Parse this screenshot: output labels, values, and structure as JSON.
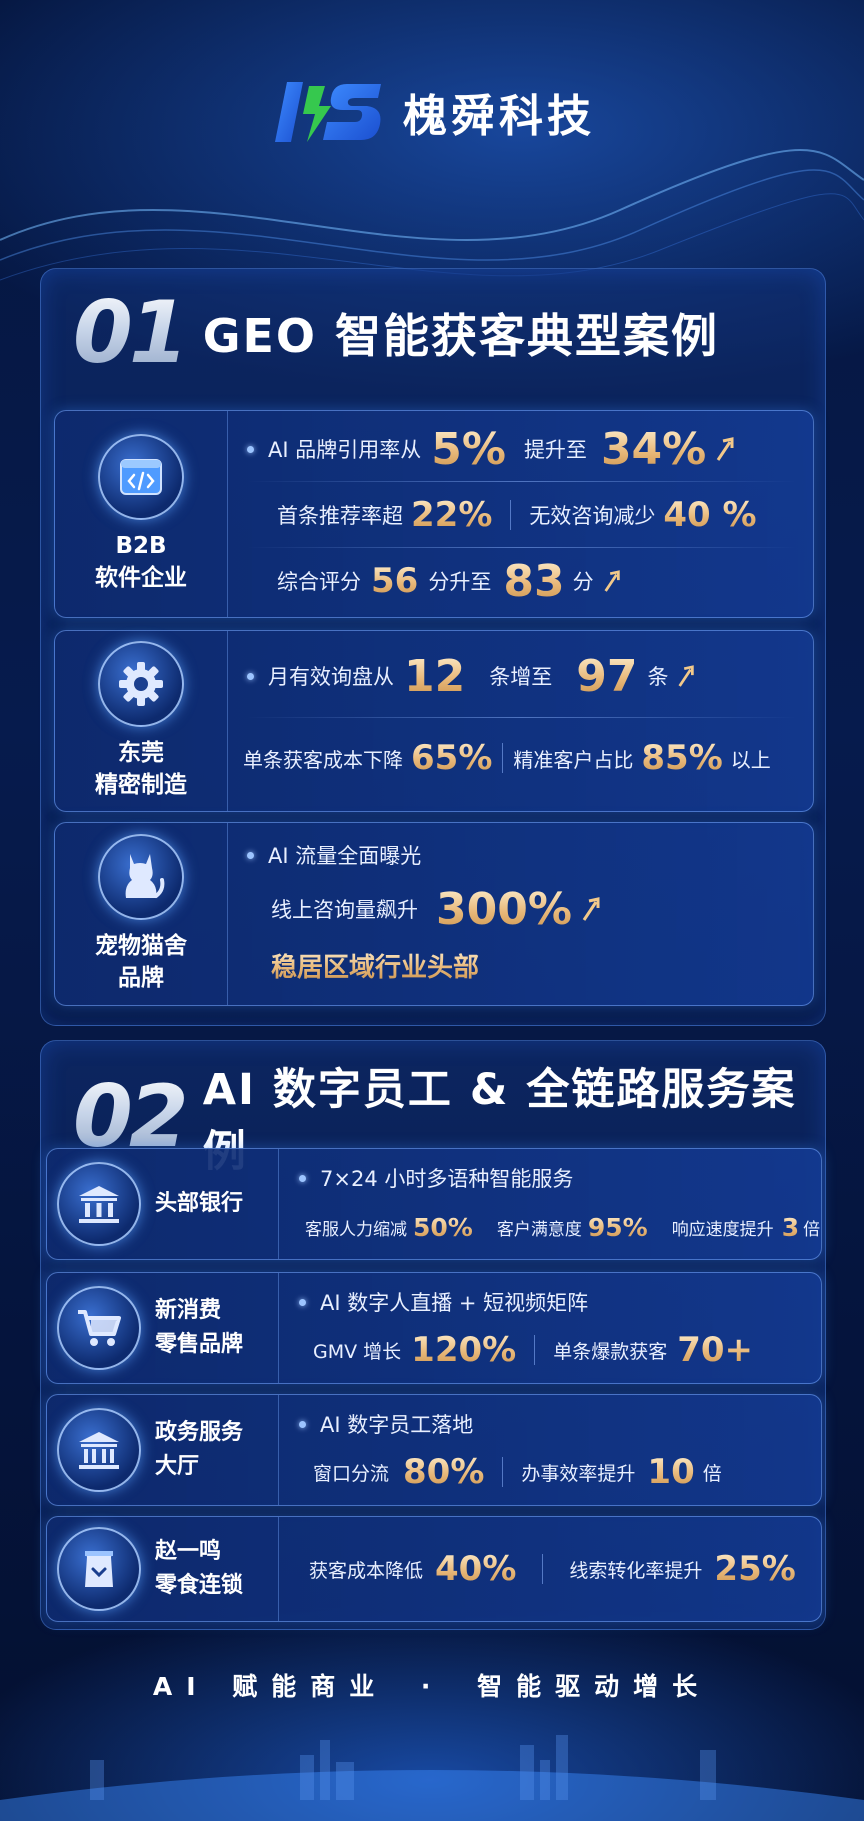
{
  "brand": {
    "name": "槐舜科技",
    "logo_text": "HS"
  },
  "section1": {
    "number": "01",
    "title": "GEO 智能获客典型案例",
    "cases": [
      {
        "name_line1": "B2B",
        "name_line2": "软件企业",
        "icon": "code-window-icon",
        "rows": [
          {
            "a": "AI 品牌引用率从",
            "v1": "5%",
            "b": "提升至",
            "v2": "34%"
          },
          {
            "a": "首条推荐率超",
            "v1": "22%",
            "b": "无效咨询减少",
            "v2": "40 %"
          },
          {
            "a": "综合评分",
            "v1": "56",
            "b": "分升至",
            "v2": "83",
            "c": "分"
          }
        ]
      },
      {
        "name_line1": "东莞",
        "name_line2": "精密制造",
        "icon": "gear-icon",
        "rows": [
          {
            "a": "月有效询盘从",
            "v1": "12",
            "b": "条增至",
            "v2": "97",
            "c": "条"
          },
          {
            "a": "单条获客成本下降",
            "v1": "65%",
            "b": "精准客户占比",
            "v2": "85%",
            "c": "以上"
          }
        ]
      },
      {
        "name_line1": "宠物猫舍",
        "name_line2": "品牌",
        "icon": "cat-icon",
        "rows": [
          {
            "a": "AI 流量全面曝光"
          },
          {
            "a": "线上咨询量飙升",
            "v1": "300%"
          },
          {
            "a": "稳居区域行业头部"
          }
        ]
      }
    ]
  },
  "section2": {
    "number": "02",
    "title": "AI 数字员工 & 全链路服务案例",
    "cases": [
      {
        "name_line1": "头部银行",
        "name_line2": "",
        "icon": "bank-icon",
        "headline": "7×24 小时多语种智能服务",
        "stats": [
          {
            "label": "客服人力缩减",
            "value": "50%",
            "unit": ""
          },
          {
            "label": "客户满意度",
            "value": "95%",
            "unit": ""
          },
          {
            "label": "响应速度提升",
            "value": "3",
            "unit": "倍"
          }
        ]
      },
      {
        "name_line1": "新消费",
        "name_line2": "零售品牌",
        "icon": "shopping-cart-icon",
        "headline": "AI 数字人直播 + 短视频矩阵",
        "stats": [
          {
            "label": "GMV 增长",
            "value": "120%",
            "unit": ""
          },
          {
            "label": "单条爆款获客",
            "value": "70+",
            "unit": ""
          }
        ]
      },
      {
        "name_line1": "政务服务",
        "name_line2": "大厅",
        "icon": "government-building-icon",
        "headline": "AI 数字员工落地",
        "stats": [
          {
            "label": "窗口分流",
            "value": "80%",
            "unit": ""
          },
          {
            "label": "办事效率提升",
            "value": "10",
            "unit": "倍"
          }
        ]
      },
      {
        "name_line1": "赵一鸣",
        "name_line2": "零食连锁",
        "icon": "snack-bag-icon",
        "headline": "",
        "stats": [
          {
            "label": "获客成本降低",
            "value": "40%",
            "unit": ""
          },
          {
            "label": "线索转化率提升",
            "value": "25%",
            "unit": ""
          }
        ]
      }
    ]
  },
  "footer": {
    "slogan_left": "AI 赋能商业",
    "dot": "·",
    "slogan_right": "智能驱动增长"
  },
  "colors": {
    "accent_gold": "#e8b879",
    "background": "#061b4d",
    "card_border": "#78aaff"
  }
}
